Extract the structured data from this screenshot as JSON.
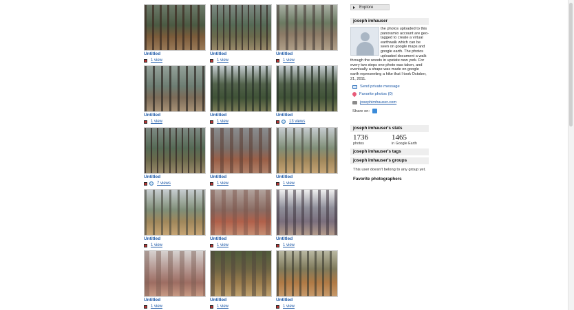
{
  "grid": {
    "items": [
      {
        "title": "Untitled",
        "views": "1 view",
        "globe": false
      },
      {
        "title": "Untitled",
        "views": "1 view",
        "globe": false
      },
      {
        "title": "Untitled",
        "views": "1 view",
        "globe": false
      },
      {
        "title": "Untitled",
        "views": "1 view",
        "globe": false
      },
      {
        "title": "Untitled",
        "views": "1 view",
        "globe": false
      },
      {
        "title": "Untitled",
        "views": "13 views",
        "globe": true
      },
      {
        "title": "Untitled",
        "views": "7 views",
        "globe": true
      },
      {
        "title": "Untitled",
        "views": "1 view",
        "globe": false
      },
      {
        "title": "Untitled",
        "views": "1 view",
        "globe": false
      },
      {
        "title": "Untitled",
        "views": "1 view",
        "globe": false
      },
      {
        "title": "Untitled",
        "views": "1 view",
        "globe": false
      },
      {
        "title": "Untitled",
        "views": "1 view",
        "globe": false
      },
      {
        "title": "Untitled",
        "views": "1 view",
        "globe": false
      },
      {
        "title": "Untitled",
        "views": "1 view",
        "globe": false
      },
      {
        "title": "Untitled",
        "views": "1 view",
        "globe": false
      }
    ]
  },
  "sidebar": {
    "explore_label": "Explore",
    "profile": {
      "name": "joseph imhauser",
      "bio": "the photos uploaded to this panoramio account are geo-tagged to create a virtual earthwalk which can be seen on google maps and google earth. The photos uploaded document a walk through the woods in upstate new york. For every two steps one photo was taken, and eventually a shape was made on google earth representing a hike that I took October, 21, 2011.",
      "send_message": "Send private message",
      "favorite_photos": "Favorite photos (0)",
      "website": "josephimhauser.com",
      "share_label": "Share on:"
    },
    "stats": {
      "header": "joseph imhauser's stats",
      "photos_count": "1736",
      "photos_label": "photos",
      "ge_count": "1465",
      "ge_label": "in Google Earth"
    },
    "tags_header": "joseph imhauser's tags",
    "groups_header": "joseph imhauser's groups",
    "groups_note": "This user doesn't belong to any group yet.",
    "favorite_photographers": "Favorite photographers"
  },
  "colors": {
    "link": "#1a57a6",
    "header_bg": "#eeeeee"
  }
}
